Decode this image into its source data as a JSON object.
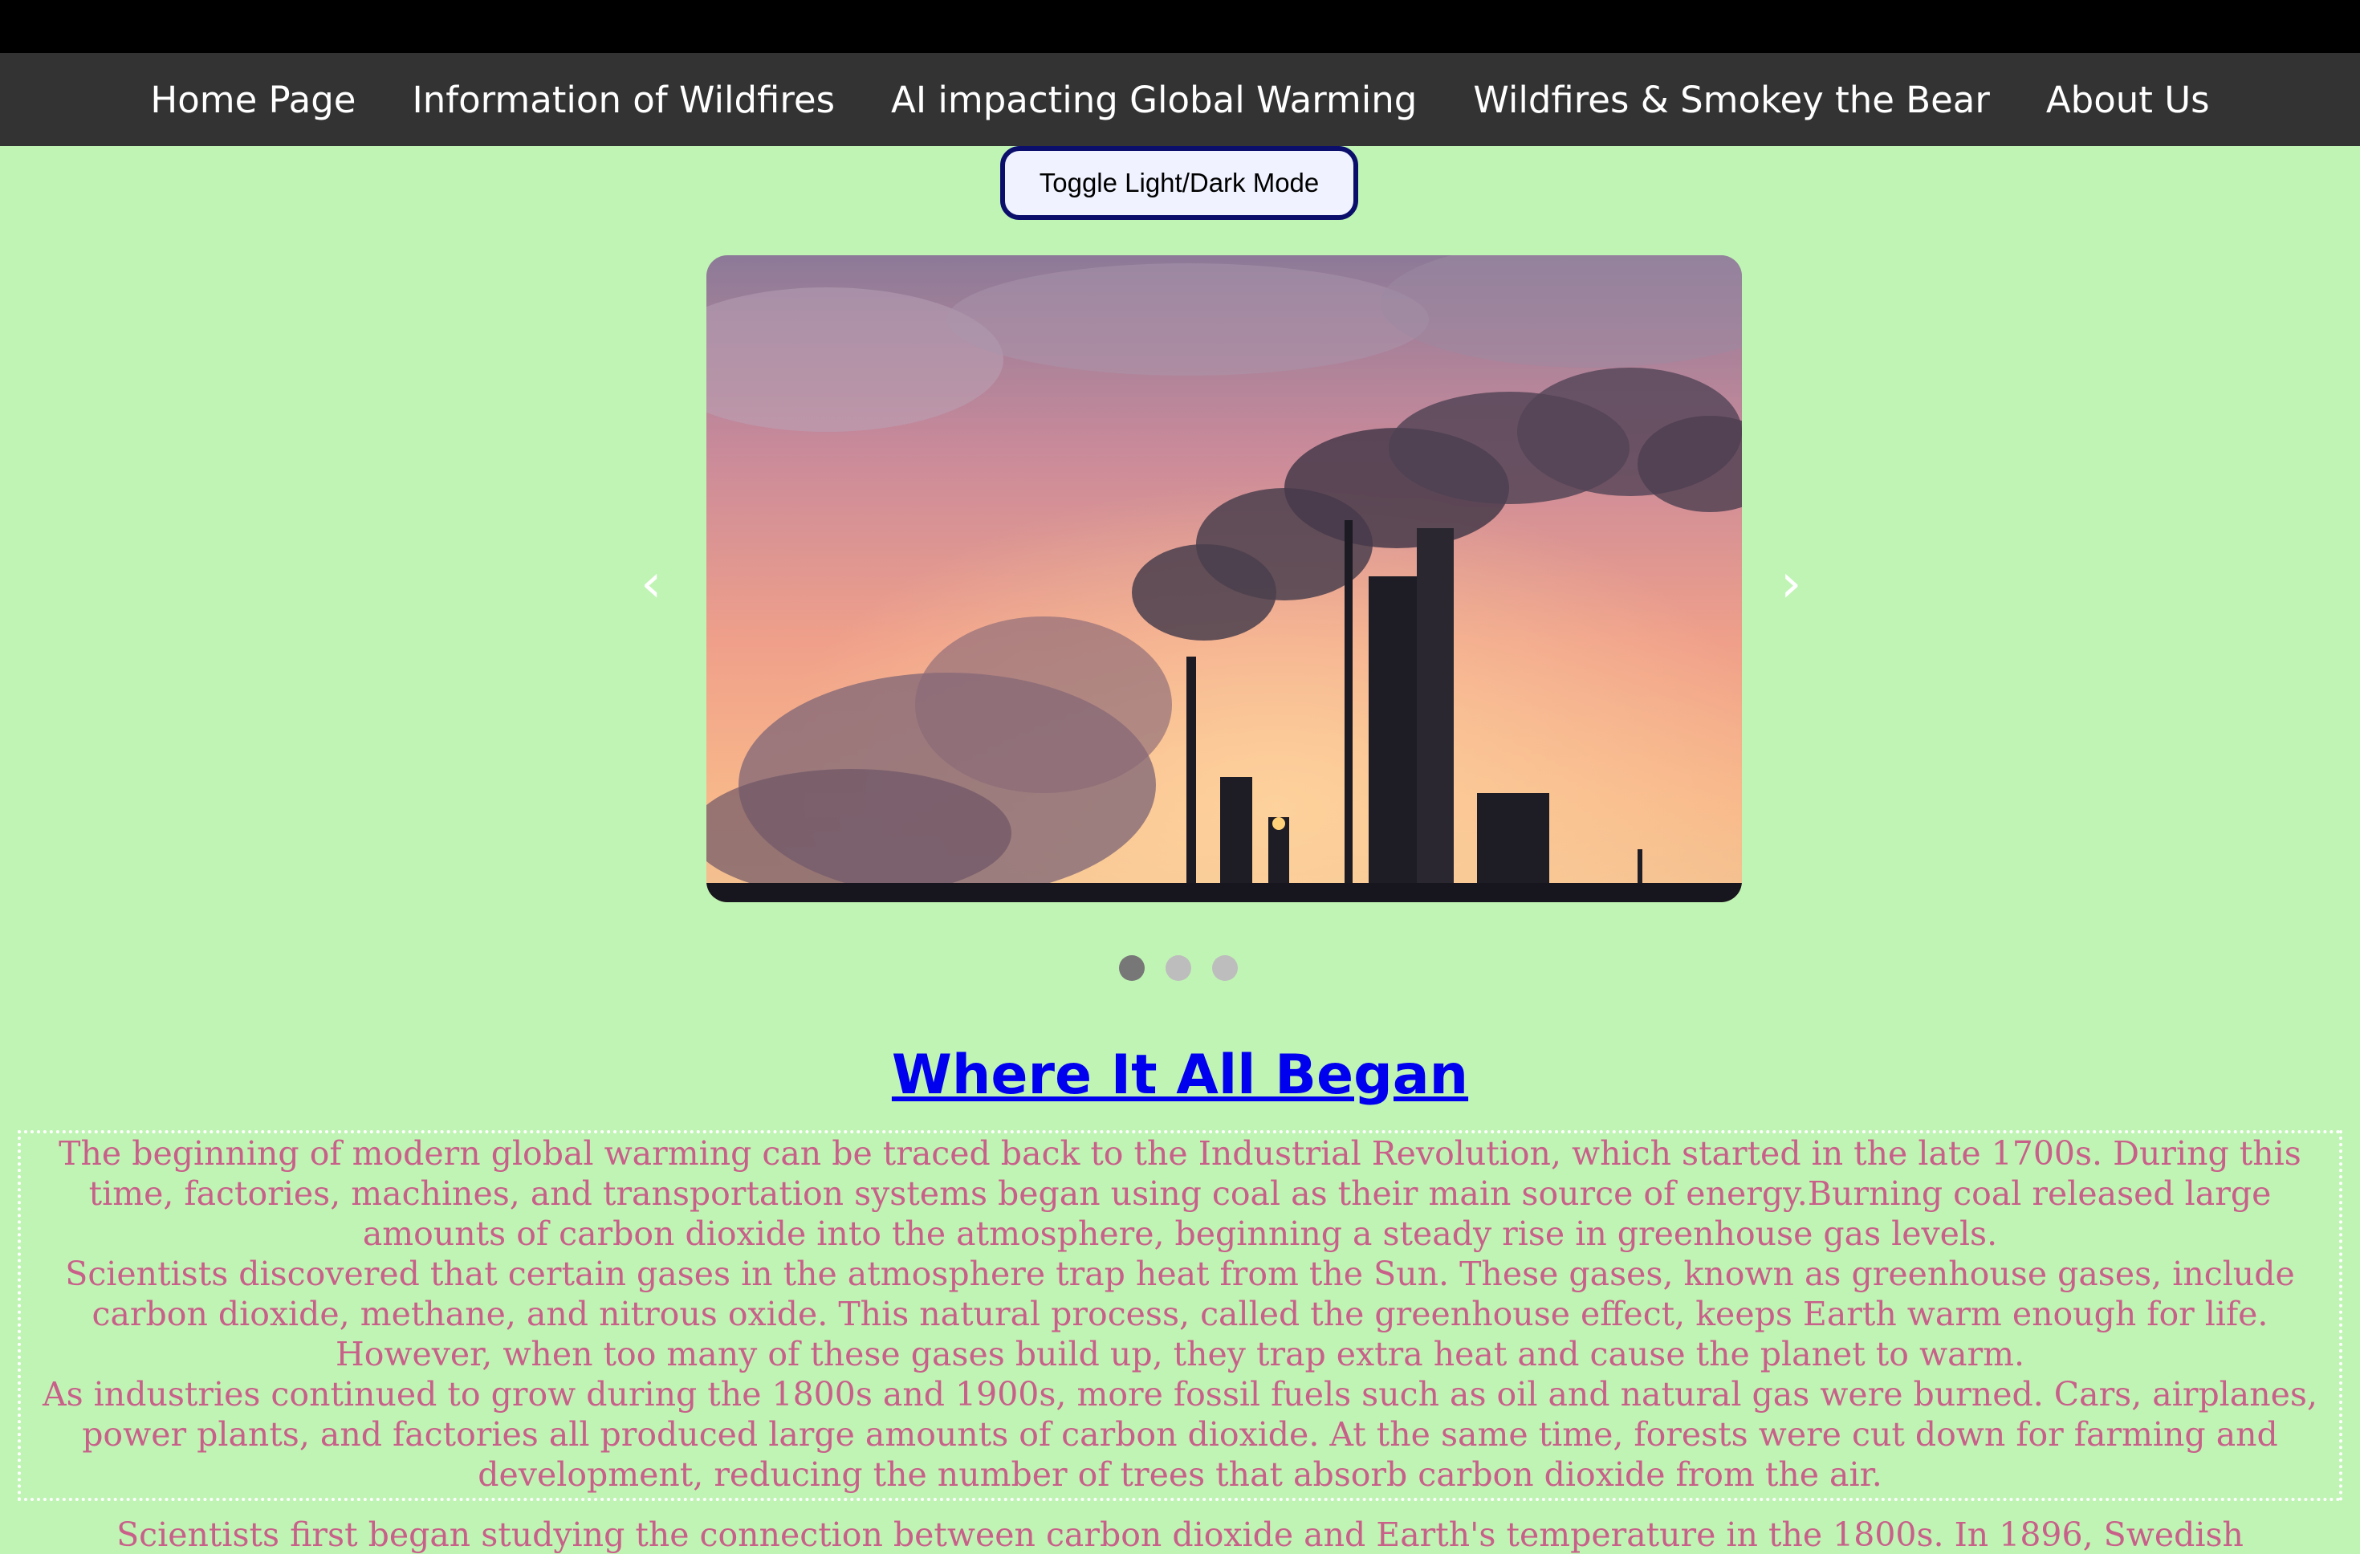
{
  "nav": {
    "items": [
      {
        "label": "Home Page"
      },
      {
        "label": "Information of Wildfires"
      },
      {
        "label": "AI impacting Global Warming"
      },
      {
        "label": "Wildfires & Smokey the Bear"
      },
      {
        "label": "About Us"
      }
    ]
  },
  "toggle": {
    "label": "Toggle Light/Dark Mode"
  },
  "carousel": {
    "prev_icon": "chevron-left-icon",
    "next_icon": "chevron-right-icon",
    "prev_glyph": "‹",
    "next_glyph": "›",
    "slide_count": 3,
    "active_slide": 1
  },
  "section": {
    "title": "Where It All Began",
    "paragraphs": [
      "The beginning of modern global warming can be traced back to the Industrial Revolution, which started in the late 1700s. During this time, factories, machines, and transportation systems began using coal as their main source of energy.Burning coal released large amounts of carbon dioxide into the atmosphere, beginning a steady rise in greenhouse gas levels.",
      "Scientists discovered that certain gases in the atmosphere trap heat from the Sun. These gases, known as greenhouse gases, include carbon dioxide, methane, and nitrous oxide. This natural process, called the greenhouse effect, keeps Earth warm enough for life. However, when too many of these gases build up, they trap extra heat and cause the planet to warm.",
      "As industries continued to grow during the 1800s and 1900s, more fossil fuels such as oil and natural gas were burned. Cars, airplanes, power plants, and factories all produced large amounts of carbon dioxide. At the same time, forests were cut down for farming and development, reducing the number of trees that absorb carbon dioxide from the air."
    ],
    "next_paragraph_partial": "Scientists first began studying the connection between carbon dioxide and Earth's temperature in the 1800s. In 1896, Swedish"
  },
  "colors": {
    "background": "#c0f4b4",
    "nav_background": "#333333",
    "title_link": "#0000ee",
    "body_text": "#c8608a"
  }
}
